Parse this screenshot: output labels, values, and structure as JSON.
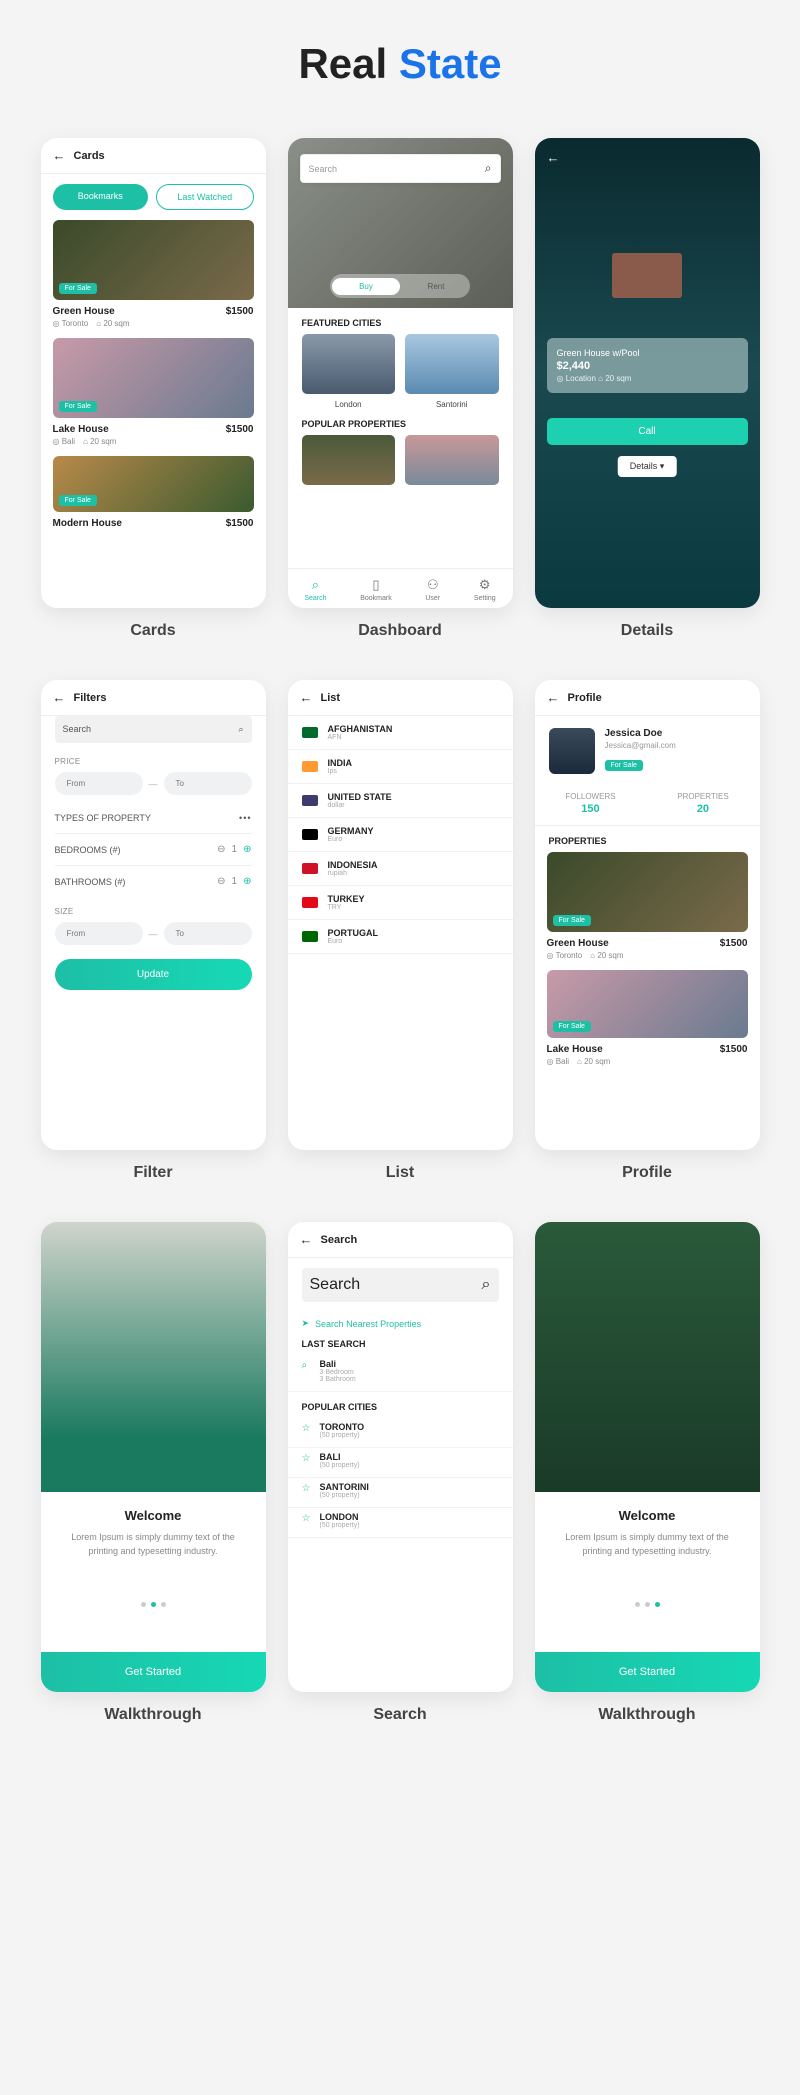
{
  "page_title": {
    "a": "Real",
    "b": "State"
  },
  "captions": [
    "Cards",
    "Dashboard",
    "Details",
    "Filter",
    "List",
    "Profile",
    "Walkthrough",
    "Search",
    "Walkthrough"
  ],
  "cards": {
    "header": "Cards",
    "tabs": [
      "Bookmarks",
      "Last Watched"
    ],
    "items": [
      {
        "badge": "For Sale",
        "name": "Green House",
        "price": "$1500",
        "loc": "Toronto",
        "size": "20 sqm"
      },
      {
        "badge": "For Sale",
        "name": "Lake House",
        "price": "$1500",
        "loc": "Bali",
        "size": "20 sqm"
      },
      {
        "badge": "For Sale",
        "name": "Modern House",
        "price": "$1500",
        "loc": "",
        "size": ""
      }
    ]
  },
  "dashboard": {
    "search": "Search",
    "toggle": [
      "Buy",
      "Rent"
    ],
    "sect1": "FEATURED CITIES",
    "cities": [
      "London",
      "Santorini"
    ],
    "sect2": "POPULAR PROPERTIES",
    "nav": [
      {
        "label": "Search",
        "active": true
      },
      {
        "label": "Bookmark",
        "active": false
      },
      {
        "label": "User",
        "active": false
      },
      {
        "label": "Setting",
        "active": false
      }
    ]
  },
  "details": {
    "name": "Green House w/Pool",
    "price": "$2,440",
    "meta": "◎ Location   ⌂ 20 sqm",
    "call": "Call",
    "select": "Details ▾"
  },
  "filter": {
    "header": "Filters",
    "search": "Search",
    "price": "PRICE",
    "from": "From",
    "to": "To",
    "types": "TYPES OF PROPERTY",
    "bed": "BEDROOMS (#)",
    "bedval": "1",
    "bath": "BATHROOMS (#)",
    "bathval": "1",
    "size": "SIZE",
    "update": "Update"
  },
  "list": {
    "header": "List",
    "items": [
      {
        "n": "AFGHANISTAN",
        "s": "AFN",
        "c": "#006a2f"
      },
      {
        "n": "INDIA",
        "s": "Ips",
        "c": "#ff9933"
      },
      {
        "n": "UNITED STATE",
        "s": "dollar",
        "c": "#3c3b6e"
      },
      {
        "n": "GERMANY",
        "s": "Euro",
        "c": "#000"
      },
      {
        "n": "INDONESIA",
        "s": "rupiah",
        "c": "#ce1126"
      },
      {
        "n": "TURKEY",
        "s": "TRY",
        "c": "#e30a17"
      },
      {
        "n": "PORTUGAL",
        "s": "Euro",
        "c": "#006600"
      }
    ]
  },
  "profile": {
    "header": "Profile",
    "name": "Jessica Doe",
    "email": "Jessica@gmail.com",
    "badge": "For Sale",
    "stats": [
      {
        "l": "FOLLOWERS",
        "v": "150"
      },
      {
        "l": "PROPERTIES",
        "v": "20"
      }
    ],
    "sect": "PROPERTIES",
    "items": [
      {
        "badge": "For Sale",
        "name": "Green House",
        "price": "$1500",
        "loc": "Toronto",
        "size": "20 sqm"
      },
      {
        "badge": "For Sale",
        "name": "Lake House",
        "price": "$1500",
        "loc": "Bali",
        "size": "20 sqm"
      }
    ]
  },
  "walk": {
    "title": "Welcome",
    "text": "Lorem Ipsum is simply dummy text of the printing and typesetting industry.",
    "btn": "Get Started"
  },
  "search": {
    "header": "Search",
    "ph": "Search",
    "nearest": "Search Nearest Properties",
    "last": "LAST SEARCH",
    "lastitem": {
      "n": "Bali",
      "s1": "3 Bedroom",
      "s2": "3 Bathroom"
    },
    "pop": "POPULAR CITIES",
    "cities": [
      {
        "n": "TORONTO",
        "s": "(50 property)"
      },
      {
        "n": "BALI",
        "s": "(50 property)"
      },
      {
        "n": "SANTORINI",
        "s": "(50 property)"
      },
      {
        "n": "LONDON",
        "s": "(50 property)"
      }
    ]
  }
}
